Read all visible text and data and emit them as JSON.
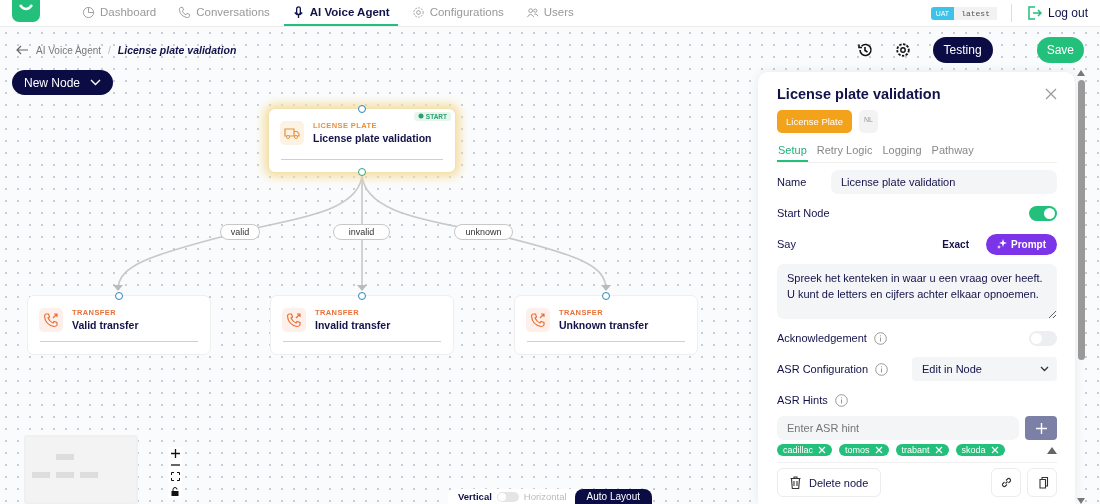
{
  "nav": {
    "items": [
      {
        "label": "Dashboard",
        "selected": false
      },
      {
        "label": "Conversations",
        "selected": false
      },
      {
        "label": "AI Voice Agent",
        "selected": true
      },
      {
        "label": "Configurations",
        "selected": false
      },
      {
        "label": "Users",
        "selected": false
      }
    ],
    "env": "UAT",
    "version": "latest",
    "logout": "Log out"
  },
  "breadcrumb": {
    "parent": "AI Voice Agent",
    "separator": "/",
    "current": "License plate validation"
  },
  "toolbar": {
    "new_node": "New Node",
    "testing": "Testing",
    "save": "Save"
  },
  "flow": {
    "nodes": [
      {
        "kind": "license_plate",
        "type_label": "LICENSE PLATE",
        "title": "License plate validation",
        "start_badge": "START",
        "selected": true
      },
      {
        "kind": "transfer",
        "type_label": "TRANSFER",
        "title": "Valid transfer",
        "selected": false
      },
      {
        "kind": "transfer",
        "type_label": "TRANSFER",
        "title": "Invalid transfer",
        "selected": false
      },
      {
        "kind": "transfer",
        "type_label": "TRANSFER",
        "title": "Unknown transfer",
        "selected": false
      }
    ],
    "edges": [
      {
        "label": "valid"
      },
      {
        "label": "invalid"
      },
      {
        "label": "unknown"
      }
    ]
  },
  "panel": {
    "title": "License plate validation",
    "tags": [
      {
        "label": "License Plate",
        "kind": "primary"
      },
      {
        "label": "NL",
        "kind": "secondary"
      }
    ],
    "tabs": [
      {
        "label": "Setup",
        "selected": true
      },
      {
        "label": "Retry Logic",
        "selected": false
      },
      {
        "label": "Logging",
        "selected": false
      },
      {
        "label": "Pathway",
        "selected": false
      }
    ],
    "name": {
      "label": "Name",
      "value": "License plate validation"
    },
    "start_node": {
      "label": "Start Node",
      "on": true
    },
    "say": {
      "label": "Say",
      "modes": [
        {
          "label": "Exact",
          "selected": false
        },
        {
          "label": "Prompt",
          "selected": true
        }
      ],
      "value": "Spreek het kenteken in waar u een vraag over heeft. U kunt de letters en cijfers achter elkaar opnoemen."
    },
    "acknowledgement": {
      "label": "Acknowledgement",
      "on": false
    },
    "asr_configuration": {
      "label": "ASR Configuration",
      "value": "Edit in Node"
    },
    "asr_hints": {
      "label": "ASR Hints",
      "placeholder": "Enter ASR hint",
      "hints": [
        "cadillac",
        "tomos",
        "trabant",
        "skoda"
      ]
    },
    "delete": "Delete node"
  },
  "layout": {
    "vertical": "Vertical",
    "horizontal": "Horizontal",
    "horizontal_on": false,
    "auto_layout": "Auto Layout"
  }
}
